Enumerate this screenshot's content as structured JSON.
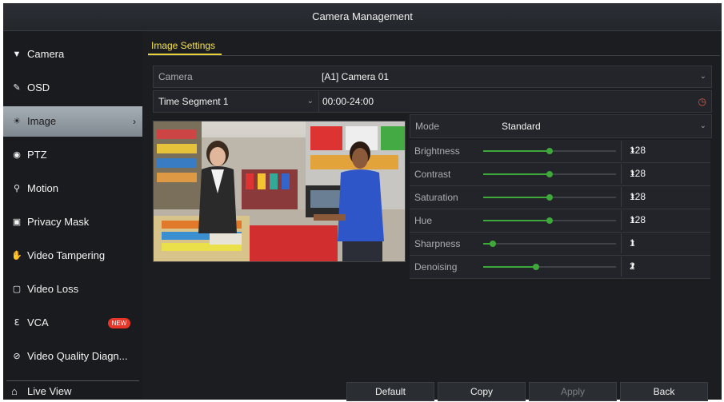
{
  "window": {
    "title": "Camera Management"
  },
  "sidebar": {
    "items": [
      {
        "label": "Camera",
        "icon": "camera-icon"
      },
      {
        "label": "OSD",
        "icon": "osd-icon"
      },
      {
        "label": "Image",
        "icon": "image-icon",
        "active": true
      },
      {
        "label": "PTZ",
        "icon": "ptz-icon"
      },
      {
        "label": "Motion",
        "icon": "motion-icon"
      },
      {
        "label": "Privacy Mask",
        "icon": "privacy-mask-icon"
      },
      {
        "label": "Video Tampering",
        "icon": "video-tampering-icon"
      },
      {
        "label": "Video Loss",
        "icon": "video-loss-icon"
      },
      {
        "label": "VCA",
        "icon": "vca-icon",
        "badge": "NEW"
      },
      {
        "label": "Video Quality Diagn...",
        "icon": "video-quality-icon"
      }
    ],
    "live_view": "Live View"
  },
  "tabs": [
    {
      "label": "Image Settings",
      "active": true
    }
  ],
  "fields": {
    "camera_label": "Camera",
    "camera_value": "[A1] Camera 01",
    "time_segment": "Time Segment 1",
    "time_range": "00:00-24:00"
  },
  "mode": {
    "label": "Mode",
    "value": "Standard"
  },
  "params": [
    {
      "label": "Brightness",
      "value": "128",
      "level": 0.5
    },
    {
      "label": "Contrast",
      "value": "128",
      "level": 0.5
    },
    {
      "label": "Saturation",
      "value": "128",
      "level": 0.5
    },
    {
      "label": "Hue",
      "value": "128",
      "level": 0.5
    },
    {
      "label": "Sharpness",
      "value": "1",
      "level": 0.07
    },
    {
      "label": "Denoising",
      "value": "2",
      "level": 0.4
    }
  ],
  "buttons": {
    "default": "Default",
    "copy": "Copy",
    "apply": "Apply",
    "back": "Back"
  },
  "colors": {
    "accent": "#e8d23a",
    "slider": "#3fa83a",
    "badge": "#e8352a",
    "active_item": "#9aa2aa"
  }
}
